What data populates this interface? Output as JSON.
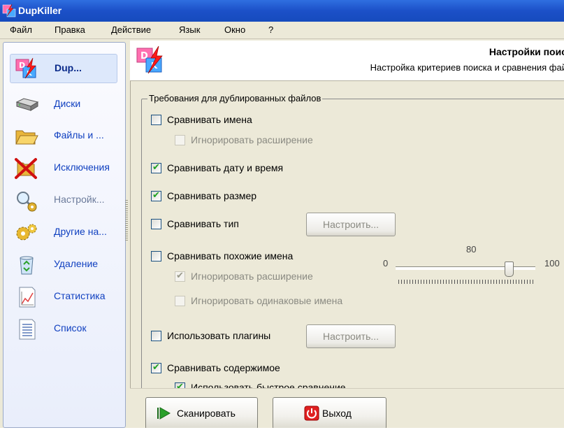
{
  "window": {
    "title": "DupKiller"
  },
  "menu": [
    "Файл",
    "Правка",
    "Действие",
    "Язык",
    "Окно",
    "?"
  ],
  "sidebar": {
    "items": [
      {
        "label": "Dup...",
        "icon": "dupkiller-logo-icon",
        "active": true
      },
      {
        "label": "Диски",
        "icon": "drive-icon"
      },
      {
        "label": "Файлы и ...",
        "icon": "folder-icon"
      },
      {
        "label": "Исключения",
        "icon": "exclusion-icon"
      },
      {
        "label": "Настройк...",
        "icon": "search-settings-icon",
        "disabled": true
      },
      {
        "label": "Другие на...",
        "icon": "gears-icon"
      },
      {
        "label": "Удаление",
        "icon": "recycle-bin-icon"
      },
      {
        "label": "Статистика",
        "icon": "chart-icon"
      },
      {
        "label": "Список",
        "icon": "list-icon"
      }
    ]
  },
  "header": {
    "title": "Настройки поис",
    "subtitle": "Настройка критериев поиска и сравнения фай"
  },
  "options": {
    "group_title": "Требования для дублированных файлов",
    "compare_names": {
      "label": "Сравнивать имена",
      "checked": false
    },
    "ignore_ext_1": {
      "label": "Игнорировать расширение",
      "checked": false,
      "disabled": true
    },
    "compare_datetime": {
      "label": "Сравнивать дату и время",
      "checked": true
    },
    "compare_size": {
      "label": "Сравнивать размер",
      "checked": true
    },
    "compare_type": {
      "label": "Сравнивать тип",
      "checked": false
    },
    "compare_similar": {
      "label": "Сравнивать похожие имена",
      "checked": false
    },
    "ignore_ext_2": {
      "label": "Игнорировать расширение",
      "checked": true,
      "disabled": true
    },
    "ignore_same_names": {
      "label": "Игнорировать одинаковые имена",
      "checked": false,
      "disabled": true
    },
    "use_plugins": {
      "label": "Использовать плагины",
      "checked": false
    },
    "compare_content": {
      "label": "Сравнивать содержимое",
      "checked": true
    },
    "fast_compare": {
      "label": "Использовать быстрое сравнение",
      "checked": true
    },
    "configure_label": "Настроить...",
    "check_mark": "✔"
  },
  "similarity_slider": {
    "min": "0",
    "max": "100",
    "value": "80"
  },
  "footer": {
    "scan_label": "Сканировать",
    "exit_label": "Выход"
  }
}
